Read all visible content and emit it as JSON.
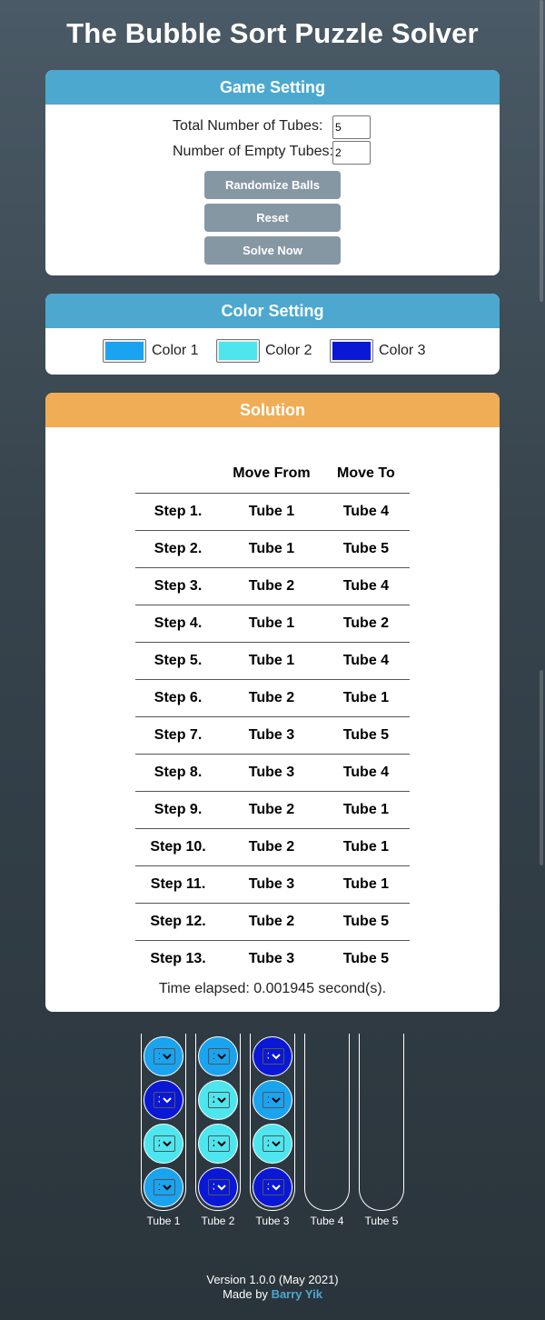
{
  "title": "The Bubble Sort Puzzle Solver",
  "game_setting": {
    "header": "Game Setting",
    "total_tubes_label": "Total Number of Tubes:",
    "total_tubes_value": "5",
    "empty_tubes_label": "Number of Empty Tubes:",
    "empty_tubes_value": "2",
    "randomize_label": "Randomize Balls",
    "reset_label": "Reset",
    "solve_label": "Solve Now"
  },
  "color_setting": {
    "header": "Color Setting",
    "colors": [
      {
        "label": "Color 1",
        "hex": "#1aa3ef"
      },
      {
        "label": "Color 2",
        "hex": "#4de6ee"
      },
      {
        "label": "Color 3",
        "hex": "#0a18d6"
      }
    ]
  },
  "solution": {
    "header": "Solution",
    "col_from": "Move From",
    "col_to": "Move To",
    "steps": [
      {
        "step": "Step 1.",
        "from": "Tube 1",
        "to": "Tube 4"
      },
      {
        "step": "Step 2.",
        "from": "Tube 1",
        "to": "Tube 5"
      },
      {
        "step": "Step 3.",
        "from": "Tube 2",
        "to": "Tube 4"
      },
      {
        "step": "Step 4.",
        "from": "Tube 1",
        "to": "Tube 2"
      },
      {
        "step": "Step 5.",
        "from": "Tube 1",
        "to": "Tube 4"
      },
      {
        "step": "Step 6.",
        "from": "Tube 2",
        "to": "Tube 1"
      },
      {
        "step": "Step 7.",
        "from": "Tube 3",
        "to": "Tube 5"
      },
      {
        "step": "Step 8.",
        "from": "Tube 3",
        "to": "Tube 4"
      },
      {
        "step": "Step 9.",
        "from": "Tube 2",
        "to": "Tube 1"
      },
      {
        "step": "Step 10.",
        "from": "Tube 2",
        "to": "Tube 1"
      },
      {
        "step": "Step 11.",
        "from": "Tube 3",
        "to": "Tube 1"
      },
      {
        "step": "Step 12.",
        "from": "Tube 2",
        "to": "Tube 5"
      },
      {
        "step": "Step 13.",
        "from": "Tube 3",
        "to": "Tube 5"
      }
    ],
    "elapsed": "Time elapsed: 0.001945 second(s)."
  },
  "tubes": [
    {
      "label": "Tube 1",
      "balls": [
        "1",
        "3",
        "2",
        "1"
      ]
    },
    {
      "label": "Tube 2",
      "balls": [
        "1",
        "2",
        "2",
        "3"
      ]
    },
    {
      "label": "Tube 3",
      "balls": [
        "3",
        "1",
        "2",
        "3"
      ]
    },
    {
      "label": "Tube 4",
      "balls": []
    },
    {
      "label": "Tube 5",
      "balls": []
    }
  ],
  "ball_options": [
    "1",
    "2",
    "3"
  ],
  "footer": {
    "version": "Version 1.0.0 (May 2021)",
    "made_by": "Made by",
    "author": "Barry Yik"
  }
}
